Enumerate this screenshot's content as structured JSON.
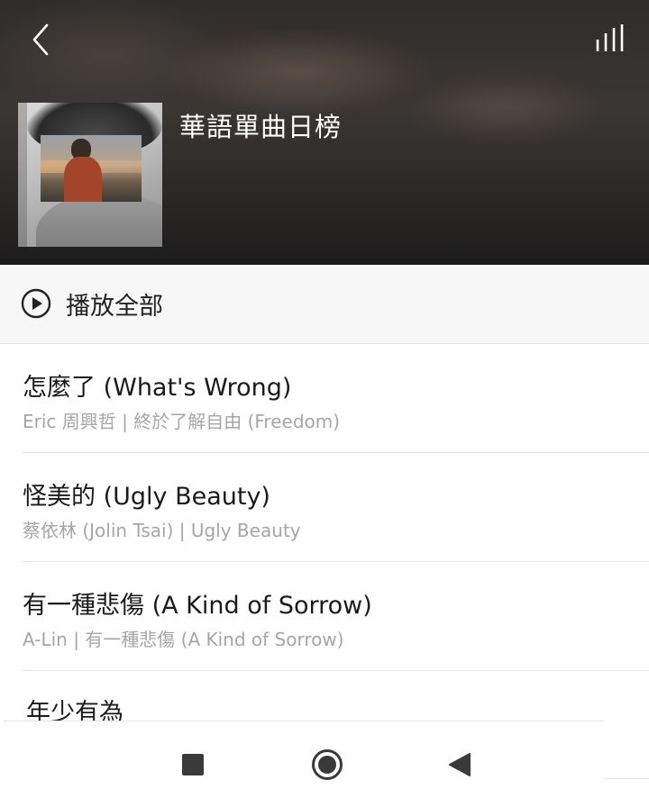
{
  "header": {
    "title": "華語單曲日榜",
    "back_icon": "chevron-left-icon",
    "right_icon": "equalizer-icon",
    "colors": {
      "title": "#ffffff",
      "background": "#2f2c2b"
    }
  },
  "play_all": {
    "label": "播放全部",
    "icon": "play-circle-icon"
  },
  "songs": [
    {
      "title": "怎麼了 (What's Wrong)",
      "subtitle": "Eric 周興哲 | 終於了解自由 (Freedom)"
    },
    {
      "title": "怪美的 (Ugly Beauty)",
      "subtitle": "蔡依林 (Jolin Tsai) | Ugly Beauty"
    },
    {
      "title": "有一種悲傷 (A Kind of Sorrow)",
      "subtitle": "A-Lin | 有一種悲傷 (A Kind of Sorrow)"
    },
    {
      "title": "年少有為",
      "subtitle": ""
    }
  ],
  "system_nav": {
    "recent_icon": "square-icon",
    "home_icon": "home-circle-icon",
    "back_icon": "triangle-back-icon"
  },
  "colors": {
    "primary_text": "#1a1a1a",
    "secondary_text": "#a6a6a6",
    "divider": "#e4e4e4"
  }
}
